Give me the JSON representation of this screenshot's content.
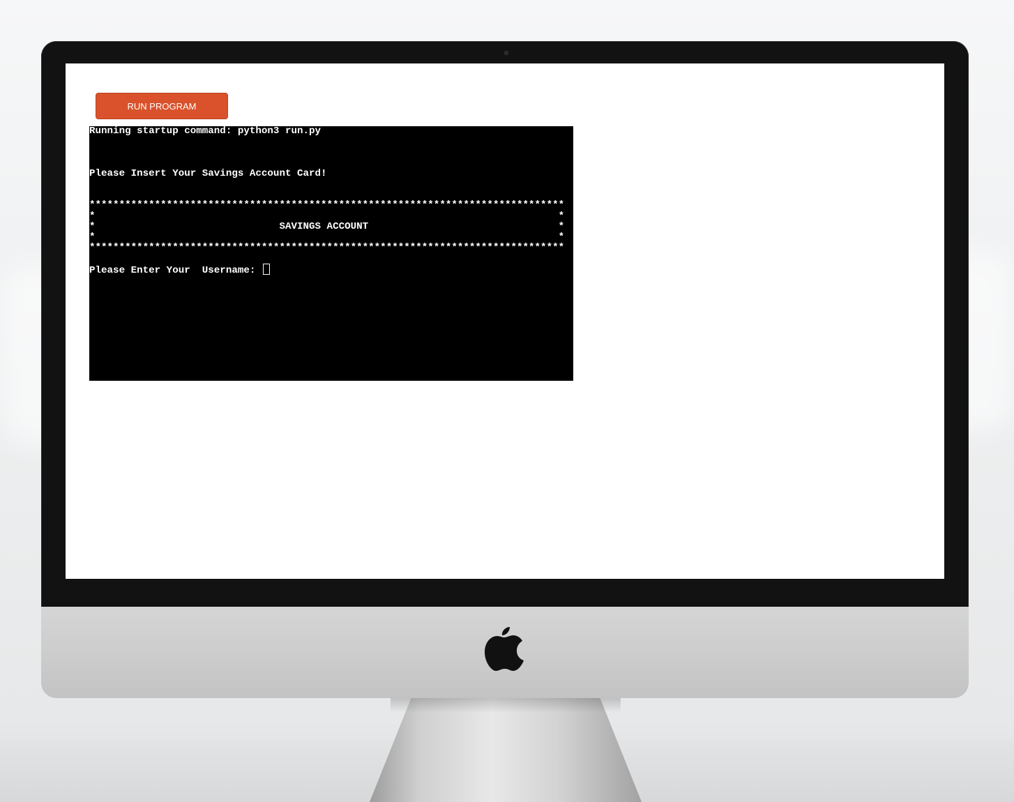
{
  "screen": {
    "run_button_label": "RUN PROGRAM"
  },
  "terminal": {
    "lines": [
      "Running startup command: python3 run.py",
      "",
      "",
      "",
      "Please Insert Your Savings Account Card!",
      "",
      "",
      "********************************************************************************",
      "*                                                                              *",
      "*                               SAVINGS ACCOUNT                                *",
      "*                                                                              *",
      "********************************************************************************",
      "",
      "Please Enter Your  Username: "
    ]
  },
  "colors": {
    "button_bg": "#d9522b",
    "terminal_bg": "#000000",
    "terminal_fg": "#ffffff"
  },
  "icons": {
    "logo": "apple-logo-icon",
    "cursor": "text-cursor-icon"
  }
}
